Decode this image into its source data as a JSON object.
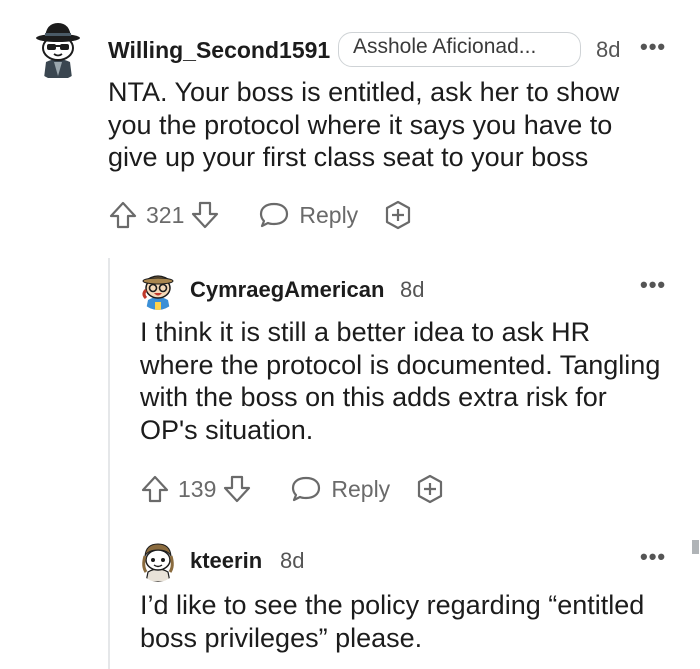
{
  "comments": [
    {
      "username": "Willing_Second1591",
      "flair": "Asshole Aficionad...",
      "time": "8d",
      "body": "NTA. Your boss is entitled, ask her to show you the protocol where it says you have to give up your first class seat to your boss",
      "body_lines": [
        "NTA. Your boss is entitled, ask her to show",
        "you the protocol where it says you have to",
        "give up your first class seat to your boss"
      ],
      "score": "321",
      "reply_label": "Reply"
    },
    {
      "username": "CymraegAmerican",
      "time": "8d",
      "body_lines": [
        "I think it is still a better idea to ask HR",
        "where the protocol is documented. Tangling",
        "with the boss on this adds extra risk for",
        "OP's situation."
      ],
      "score": "139",
      "reply_label": "Reply"
    },
    {
      "username": "kteerin",
      "time": "8d",
      "body_lines": [
        "I’d like to see the policy regarding “entitled",
        "boss privileges” please."
      ]
    }
  ],
  "icons": {
    "upvote": "upvote-arrow-icon",
    "downvote": "downvote-arrow-icon",
    "reply": "speech-bubble-icon",
    "award": "plus-award-icon",
    "more": "more-options-icon"
  },
  "colors": {
    "text": "#1c1c1c",
    "meta": "#6a6a6a",
    "thread_line": "#e5e7e9"
  }
}
